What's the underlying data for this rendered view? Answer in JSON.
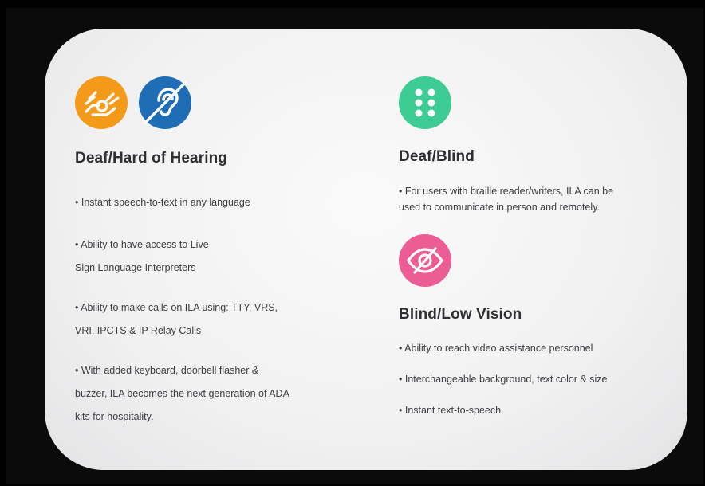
{
  "colors": {
    "orange": "#f39a1b",
    "blue": "#1f6db5",
    "green": "#3dcc94",
    "pink": "#ec5d96",
    "heading_text": "#2f2f33",
    "body_text": "#3d3d42"
  },
  "left": {
    "icons": [
      "sign-language-icon",
      "hearing-impaired-icon"
    ],
    "heading": "Deaf/Hard of Hearing",
    "items": [
      {
        "lines": [
          "• Instant speech-to-text in any language"
        ]
      },
      {
        "lines": [
          "• Ability to have access to Live",
          "Sign Language Interpreters"
        ]
      },
      {
        "lines": [
          "• Ability to make calls on ILA using: TTY, VRS,",
          "VRI, IPCTS & IP Relay Calls"
        ]
      },
      {
        "lines": [
          "• With added keyboard, doorbell flasher &",
          "buzzer, ILA becomes the next generation of ADA",
          "kits for hospitality."
        ]
      }
    ]
  },
  "right_top": {
    "icon": "braille-icon",
    "heading": "Deaf/Blind",
    "items": [
      {
        "lines": [
          "• For users with braille reader/writers, ILA can be",
          "used to communicate in person and remotely."
        ]
      }
    ]
  },
  "right_bottom": {
    "icon": "eye-slash-icon",
    "heading": "Blind/Low Vision",
    "items": [
      {
        "lines": [
          "• Ability to reach video assistance personnel"
        ]
      },
      {
        "lines": [
          "•  Interchangeable background, text color & size"
        ]
      },
      {
        "lines": [
          "• Instant text-to-speech"
        ]
      }
    ]
  }
}
